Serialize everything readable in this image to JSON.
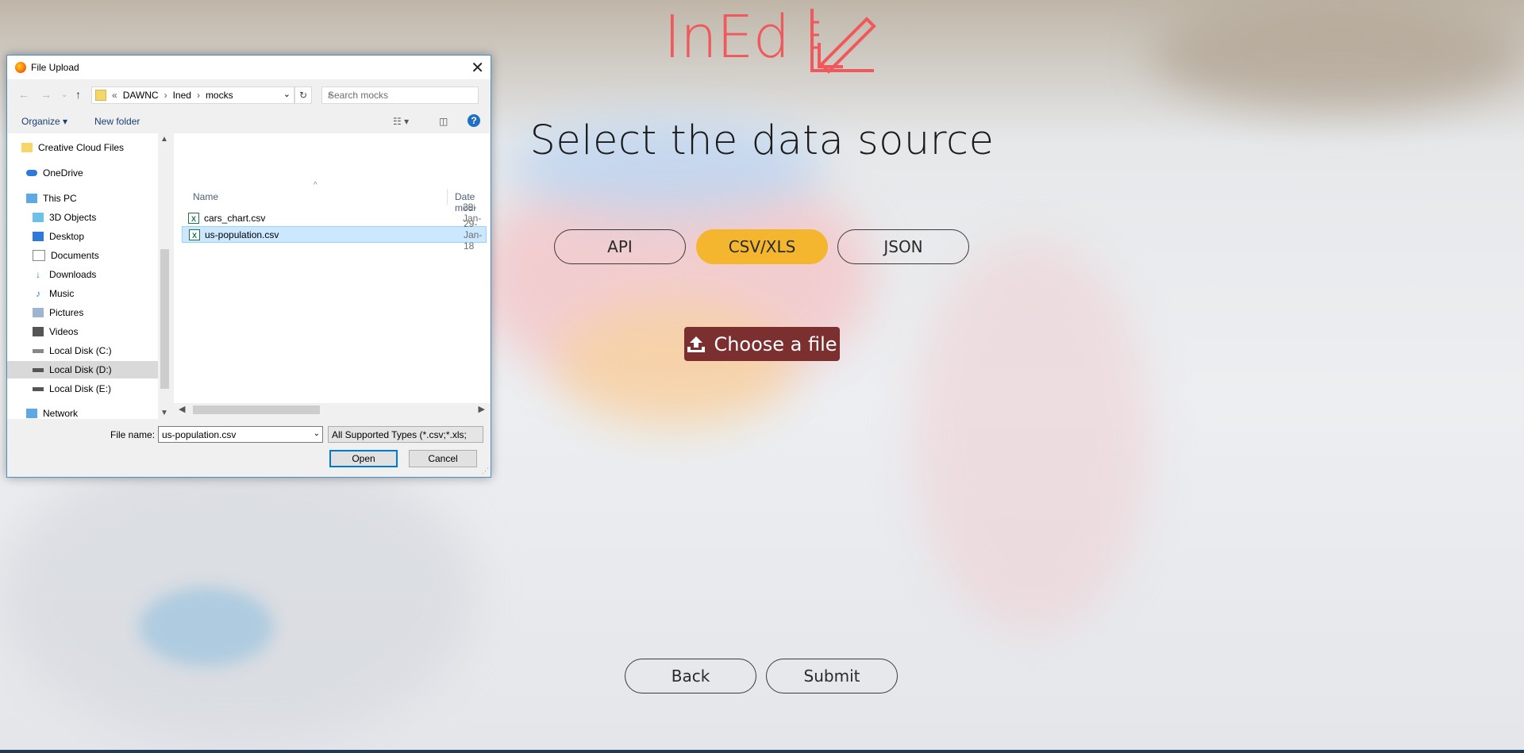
{
  "app": {
    "logo_text": "InEd",
    "page_title": "Select the data source",
    "source_tabs": [
      {
        "label": "API",
        "active": false
      },
      {
        "label": "CSV/XLS",
        "active": true
      },
      {
        "label": "JSON",
        "active": false
      }
    ],
    "choose_file_label": "Choose a file",
    "back_label": "Back",
    "submit_label": "Submit",
    "colors": {
      "accent": "#f5b62f",
      "logo": "#f0585c",
      "choose_file": "#7b2f2f"
    }
  },
  "dialog": {
    "title": "File Upload",
    "breadcrumb": [
      "DAWNC",
      "Ined",
      "mocks"
    ],
    "breadcrumb_prefix": "«",
    "search_placeholder": "Search mocks",
    "toolbar": {
      "organize": "Organize",
      "new_folder": "New folder"
    },
    "sidebar": [
      {
        "label": "Creative Cloud Files",
        "icon": "creative-cloud-icon"
      },
      {
        "label": "OneDrive",
        "icon": "onedrive-icon"
      },
      {
        "label": "This PC",
        "icon": "computer-icon"
      },
      {
        "label": "3D Objects",
        "icon": "3d-objects-icon"
      },
      {
        "label": "Desktop",
        "icon": "desktop-icon"
      },
      {
        "label": "Documents",
        "icon": "documents-icon"
      },
      {
        "label": "Downloads",
        "icon": "downloads-icon"
      },
      {
        "label": "Music",
        "icon": "music-icon"
      },
      {
        "label": "Pictures",
        "icon": "pictures-icon"
      },
      {
        "label": "Videos",
        "icon": "videos-icon"
      },
      {
        "label": "Local Disk (C:)",
        "icon": "drive-icon"
      },
      {
        "label": "Local Disk (D:)",
        "icon": "drive-icon",
        "selected": true
      },
      {
        "label": "Local Disk (E:)",
        "icon": "drive-icon"
      },
      {
        "label": "Network",
        "icon": "network-icon"
      }
    ],
    "columns": {
      "name": "Name",
      "date": "Date modi"
    },
    "files": [
      {
        "name": "cars_chart.csv",
        "date": "29-Jan-18"
      },
      {
        "name": "us-population.csv",
        "date": "29-Jan-18",
        "selected": true
      }
    ],
    "file_name_label": "File name:",
    "file_name_value": "us-population.csv",
    "file_type": "All Supported Types (*.csv;*.xls;",
    "open_label": "Open",
    "cancel_label": "Cancel"
  }
}
